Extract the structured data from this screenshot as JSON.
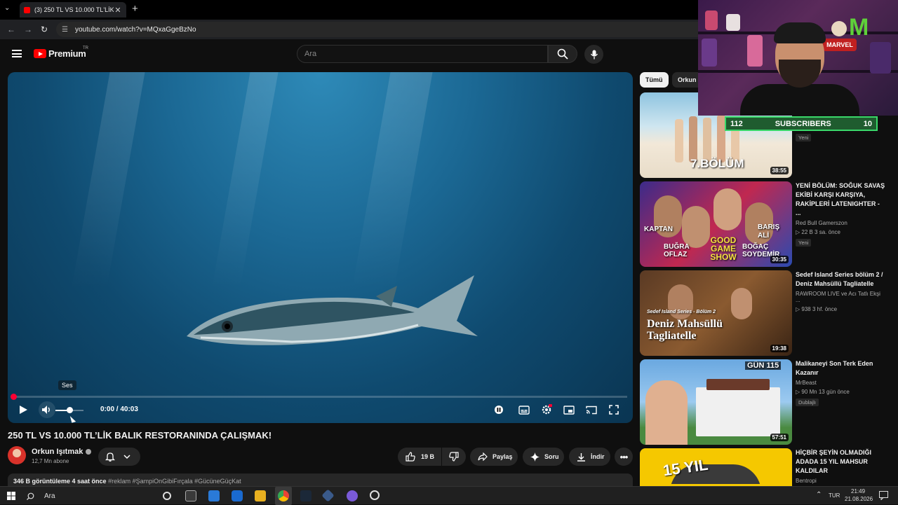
{
  "browser": {
    "tab_title": "(3) 250 TL VS 10.000 TL'LİK BALI",
    "tab_close": "✕",
    "new_tab": "+",
    "url": "youtube.com/watch?v=MQxaGgeBzNo"
  },
  "masthead": {
    "brand": "Premium",
    "region": "TR",
    "search_placeholder": "Ara"
  },
  "player": {
    "tooltip": "Ses",
    "time": "0:00 / 40:03",
    "volume_level": 0.5,
    "progress": 0
  },
  "video": {
    "title": "250 TL VS 10.000 TL’LİK BALIK RESTORANINDA ÇALIŞMAK!",
    "channel": "Orkun Işıtmak",
    "subscribers": "12,7 Mn abone",
    "likes": "19 B",
    "share": "Paylaş",
    "ask": "Soru",
    "download": "İndir",
    "views_time": "346 B görüntüleme  4 saat önce",
    "hashtags": "#reklam #ŞampiOnGibiFırçala #GücüneGüçKat"
  },
  "chips": [
    "Tümü",
    "Orkun I"
  ],
  "recommendations": [
    {
      "title": "",
      "channel": "",
      "meta": "",
      "badge": "Yeni",
      "duration": "38:55",
      "thumb_text": "7.BÖLÜM"
    },
    {
      "title": "YENİ BÖLÜM: SOĞUK SAVAŞ EKİBİ KARŞI KARŞIYA, RAKİPLERİ LATENIGHTER - ...",
      "channel": "Red Bull Gamerszon",
      "meta": "▷ 22 B  3 sa. önce",
      "badge": "Yeni",
      "duration": "30:35",
      "thumb_text_1": "KAPTAN",
      "thumb_text_2": "BARIŞ ALİ",
      "thumb_text_3": "BUĞRA OFLAZ",
      "thumb_text_4": "GOOD GAME SHOW",
      "thumb_text_5": "BOĞAÇ SOYDEMİR"
    },
    {
      "title": "Sedef Island Series bölüm 2 / Deniz Mahsüllü Tagliatelle",
      "channel": "RAWROOM LIVE ve Acı Tatlı Ekşi ...",
      "meta": "▷ 938  3 hf. önce",
      "badge": "",
      "duration": "19:38",
      "thumb_text_small": "Sedef Island Series - Bölüm 2",
      "thumb_text": "Deniz Mahsüllü Tagliatelle"
    },
    {
      "title": "Malikaneyi Son Terk Eden Kazanır",
      "channel": "MrBeast",
      "meta": "▷ 90 Mn  13 gün önce",
      "badge": "Dublajlı",
      "duration": "57:51",
      "thumb_text": "GÜN 115"
    },
    {
      "title": "HİÇBİR ŞEYİN OLMADIĞI ADADA 15 YIL MAHSUR KALDILAR",
      "channel": "Bentropi",
      "meta": "",
      "badge": "",
      "duration": "",
      "thumb_text": "15 YIL"
    }
  ],
  "overlay": {
    "sub_left": "112",
    "sub_label": "SUBSCRIBERS",
    "sub_right": "10",
    "monster": "M",
    "marvel": "MARVEL"
  },
  "taskbar": {
    "search": "Ara",
    "lang": "TUR",
    "time": "21:49",
    "date": "21.08.2026"
  },
  "colors": {
    "accent": "#ff0000",
    "sub_bar": "#3ad86a"
  }
}
